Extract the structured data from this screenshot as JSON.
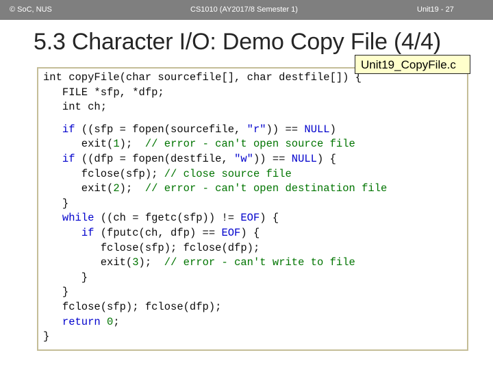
{
  "header": {
    "left": "© SoC, NUS",
    "center": "CS1010 (AY2017/8 Semester 1)",
    "right": "Unit19 - 27"
  },
  "title": "5.3 Character I/O: Demo Copy File (4/4)",
  "file_tag": "Unit19_CopyFile.c",
  "colors": {
    "header_bar": "#7f7f7f",
    "code_border": "#c4bd97",
    "file_tag_bg": "#ffffcc",
    "keyword": "#0000cc",
    "comment": "#007400"
  },
  "code": {
    "l1": "int copyFile(char sourcefile[], char destfile[]) {",
    "l2": "   FILE *sfp, *dfp;",
    "l3": "   int ch;",
    "l4": "   if ((sfp = fopen(sourcefile, \"r\")) == NULL)",
    "l5": "      exit(1);  // error - can't open source file",
    "l6": "   if ((dfp = fopen(destfile, \"w\")) == NULL) {",
    "l7": "      fclose(sfp); // close source file",
    "l8": "      exit(2);  // error - can't open destination file",
    "l9": "   }",
    "l10": "   while ((ch = fgetc(sfp)) != EOF) {",
    "l11": "      if (fputc(ch, dfp) == EOF) {",
    "l12": "         fclose(sfp); fclose(dfp);",
    "l13": "         exit(3);  // error - can't write to file",
    "l14": "      }",
    "l15": "   }",
    "l16": "   fclose(sfp); fclose(dfp);",
    "l17": "   return 0;",
    "l18": "}"
  }
}
